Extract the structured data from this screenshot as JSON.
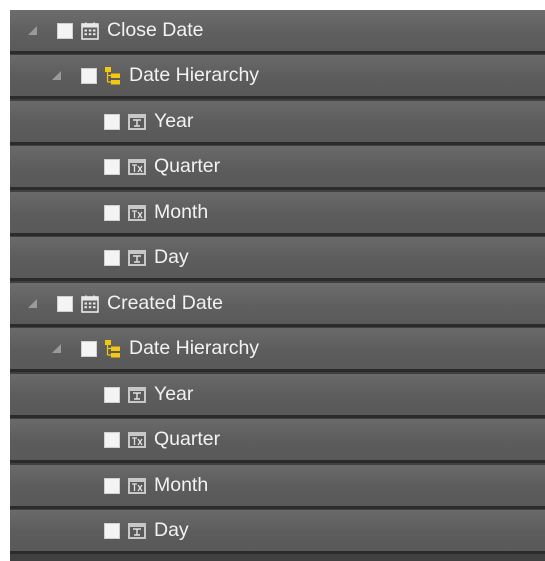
{
  "tables": [
    {
      "label": "Close Date",
      "hierarchy": {
        "label": "Date Hierarchy",
        "levels": [
          {
            "label": "Year",
            "icon": "date-level-icon"
          },
          {
            "label": "Quarter",
            "icon": "date-level-calc-icon"
          },
          {
            "label": "Month",
            "icon": "date-level-calc-icon"
          },
          {
            "label": "Day",
            "icon": "date-level-icon"
          }
        ]
      }
    },
    {
      "label": "Created Date",
      "hierarchy": {
        "label": "Date Hierarchy",
        "levels": [
          {
            "label": "Year",
            "icon": "date-level-icon"
          },
          {
            "label": "Quarter",
            "icon": "date-level-calc-icon"
          },
          {
            "label": "Month",
            "icon": "date-level-calc-icon"
          },
          {
            "label": "Day",
            "icon": "date-level-icon"
          }
        ]
      }
    }
  ],
  "colors": {
    "row_bg": "#5e5e5e",
    "row_separator": "#2b2b2b",
    "text": "#f2f2f2",
    "hierarchy_icon": "#f2c811"
  }
}
